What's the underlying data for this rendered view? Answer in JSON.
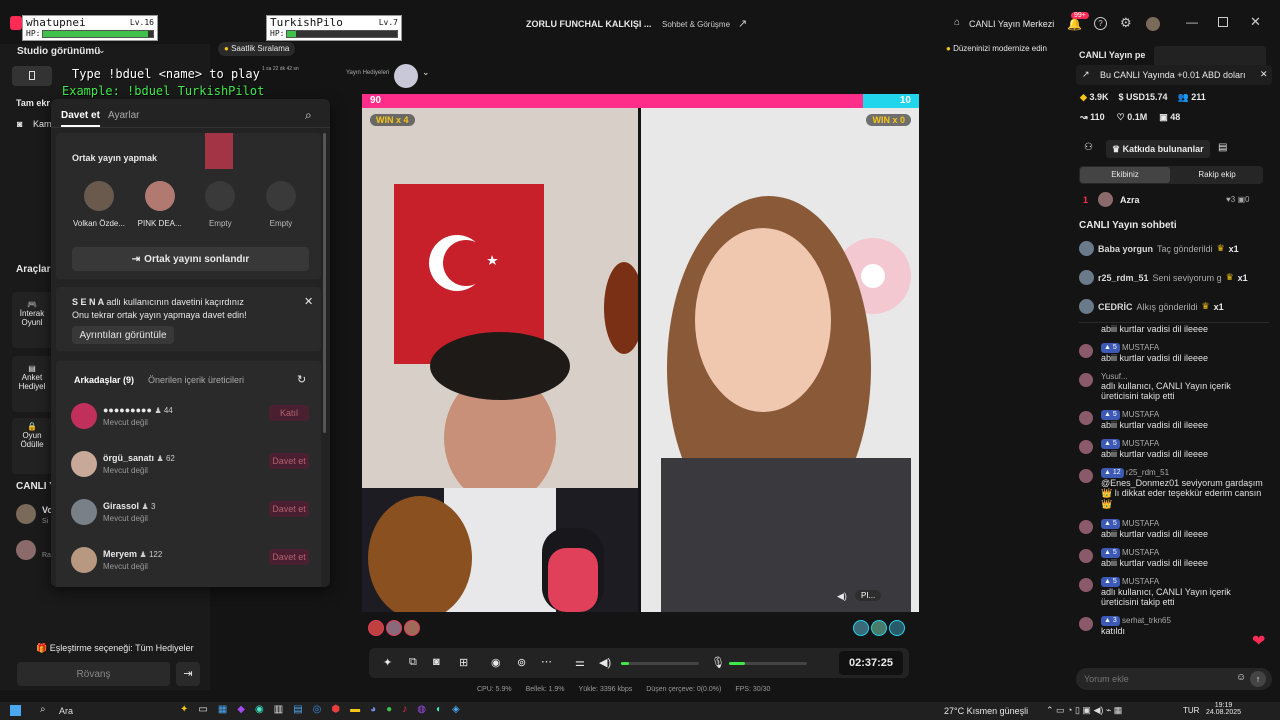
{
  "overlay": {
    "player1": {
      "name": "whatupnei",
      "level": "Lv.16",
      "hp_label": "HP:",
      "hp": 0.95
    },
    "player2": {
      "name": "TurkishPilo",
      "level": "Lv.7",
      "hp_label": "HP:",
      "hp": 0.08
    },
    "cmd1": "Type !bduel <name> to play",
    "cmd2": "Example: !bduel TurkishPilot"
  },
  "titlebar": {
    "stream_title": "ZORLU FUNCHAL KALKIŞI ...",
    "category": "Sohbet & Görüşme",
    "live_center": "CANLI Yayın Merkezi",
    "notif_badge": "99+"
  },
  "left": {
    "studio_view": "Studio görünümü",
    "full_screen": "Tam ekr",
    "camera": "Kam",
    "tools": "Araçlar",
    "tool1a": "İnterak",
    "tool1b": "Oyunl",
    "tool2a": "Anket",
    "tool2b": "Hediyel",
    "tool3a": "Oyun",
    "tool3b": "Ödülle",
    "live_v": "CANLI Y",
    "user_v1": "Vo",
    "user_v1s": "Si",
    "user_v2": "Ra",
    "match_option": "Eşleştirme seçeneği: Tüm Hediyeler",
    "rematch": "Rövanş"
  },
  "top_chips": {
    "hourly_rank": "Saatlik Sıralama",
    "timer": "1 sa 22 dk 42 sn",
    "gifts": "Yayın Hediyeleri",
    "modernize": "Düzeninizi modernize edin"
  },
  "panel": {
    "tab_invite": "Davet et",
    "tab_settings": "Ayarlar",
    "cohost_title": "Ortak yayın yapmak",
    "slots": [
      {
        "label": "Volkan Özde...",
        "color": "#6a5a4e"
      },
      {
        "label": "PINK DEA...",
        "color": "#b07a70"
      },
      {
        "label": "Empty",
        "color": "#3a3a3a"
      },
      {
        "label": "Empty",
        "color": "#3a3a3a"
      }
    ],
    "end_cohost": "Ortak yayını sonlandır",
    "notice_user": "S E N A",
    "notice_text": "adlı kullanıcının davetini kaçırdınız",
    "notice_sub": "Onu tekrar ortak yayın yapmaya davet edin!",
    "details_btn": "Ayrıntıları görüntüle",
    "friends_tab": "Arkadaşlar (9)",
    "suggested_tab": "Önerilen içerik üreticileri",
    "friends": [
      {
        "name": "●●●●●●●●●",
        "count": "44",
        "status": "Mevcut değil",
        "action": "Katıl",
        "color": "#c0305a"
      },
      {
        "name": "örgü_sanatı",
        "count": "62",
        "status": "Mevcut değil",
        "action": "Davet et",
        "color": "#c8a898"
      },
      {
        "name": "Girassol",
        "count": "3",
        "status": "Mevcut değil",
        "action": "Davet et",
        "color": "#7a8088"
      },
      {
        "name": "Meryem",
        "count": "122",
        "status": "Mevcut değil",
        "action": "Davet et",
        "color": "#b89880"
      }
    ]
  },
  "battle": {
    "score_left": "90",
    "score_right": "10",
    "left_ratio": 0.9,
    "win_left": "WIN x 4",
    "win_right": "WIN x 0",
    "right_tag": "PI..."
  },
  "controls": {
    "time": "02:37:25",
    "volume": 0.1,
    "mic": 0.2
  },
  "stats": {
    "cpu": "CPU: 5.9%",
    "mem": "Bellek: 1.9%",
    "upload": "Yükle: 3396 kbps",
    "drops": "Düşen çerçeve: 0(0.0%)",
    "fps": "FPS: 30/30"
  },
  "right": {
    "live_title": "CANLI Yayın pe",
    "promo": "Bu CANLI Yayında +0.01 ABD doları",
    "stat_diamond": "3.9K",
    "stat_usd": "USD15.74",
    "stat_viewers": "211",
    "stat_shares": "110",
    "stat_likes": "0.1M",
    "stat_gifts": "48",
    "contributors": "Katkıda bulunanlar",
    "team_tab": "Ekibiniz",
    "rival_tab": "Rakip ekip",
    "rank": "1",
    "top_user": "Azra",
    "top_hearts": "3",
    "top_gifts": "0",
    "chat_title": "CANLI Yayın sohbeti",
    "gift_rows": [
      {
        "user": "Baba yorgun",
        "text": "Taç gönderildi",
        "mult": "x1"
      },
      {
        "user": "r25_rdm_51",
        "text": "Seni seviyorum g",
        "mult": "x1"
      },
      {
        "user": "CEDRİC",
        "text": "Alkış gönderildi",
        "mult": "x1"
      }
    ],
    "messages": [
      {
        "user": "",
        "level": "",
        "text": "abiii kurtlar vadisi dil ileeee"
      },
      {
        "user": "MUSTAFA",
        "level": "5",
        "text": "abiii kurtlar vadisi dil ileeee"
      },
      {
        "user": "Yusuf...",
        "level": "",
        "text": "adlı kullanıcı, CANLI Yayın içerik üreticisini takip etti"
      },
      {
        "user": "MUSTAFA",
        "level": "5",
        "text": "abiii kurtlar vadisi dil ileeee"
      },
      {
        "user": "MUSTAFA",
        "level": "5",
        "text": "abiii kurtlar vadisi dil ileeee"
      },
      {
        "user": "r25_rdm_51",
        "level": "12",
        "text": "@Enes_Donmez01 seviyorum gardaşım 👑 lı dikkat eder teşekkür ederim cansın 👑"
      },
      {
        "user": "MUSTAFA",
        "level": "5",
        "text": "abiii kurtlar vadisi dil ileeee"
      },
      {
        "user": "MUSTAFA",
        "level": "5",
        "text": "abiii kurtlar vadisi dil ileeee"
      },
      {
        "user": "MUSTAFA",
        "level": "5",
        "text": "adlı kullanıcı, CANLI Yayın içerik üreticisini takip etti"
      },
      {
        "user": "serhat_trkn65",
        "level": "3",
        "text": "katıldı"
      }
    ],
    "comment_placeholder": "Yorum ekle"
  },
  "taskbar": {
    "search": "Ara",
    "weather": "27°C",
    "weather_desc": "Kısmen güneşli",
    "lang": "TUR",
    "time": "19:19",
    "date": "24.08.2025"
  },
  "colors": {
    "accent": "#fe2c55",
    "pink": "#ff2d8a",
    "cyan": "#20d5ec"
  }
}
